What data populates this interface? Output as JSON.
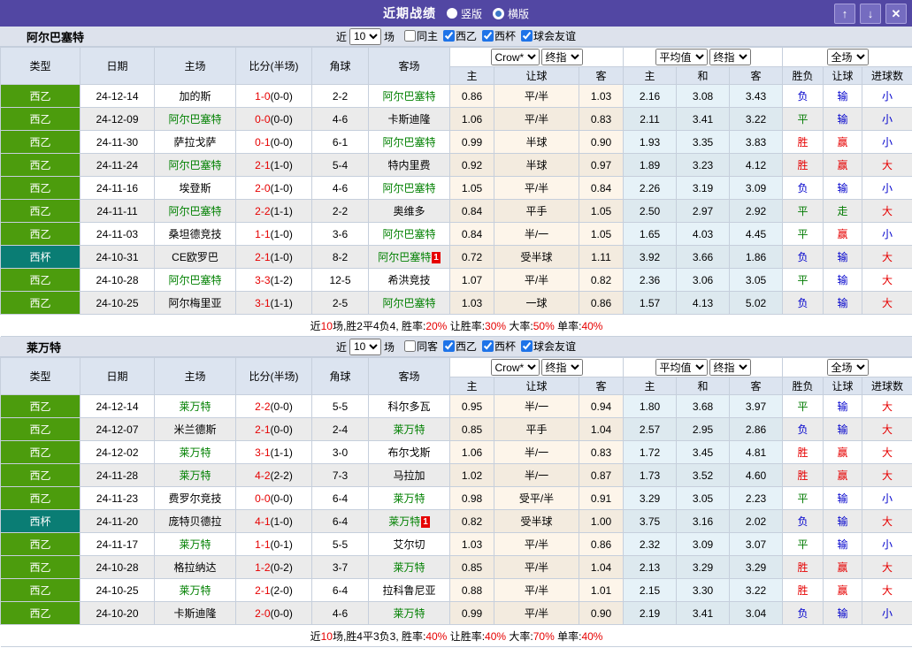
{
  "title_bar": {
    "title": "近期战绩",
    "options": [
      {
        "label": "竖版",
        "selected": false
      },
      {
        "label": "横版",
        "selected": true
      }
    ],
    "buttons": {
      "up": "↑",
      "down": "↓",
      "close": "✕"
    }
  },
  "columns": {
    "type": "类型",
    "date": "日期",
    "home": "主场",
    "score": "比分(半场)",
    "corner": "角球",
    "away": "客场",
    "crow": "Crow*",
    "final": "终指",
    "avg": "平均值",
    "full": "全场",
    "sub_crow": [
      "主",
      "让球",
      "客"
    ],
    "sub_avg": [
      "主",
      "和",
      "客"
    ],
    "sub_result": [
      "胜负",
      "让球",
      "进球数"
    ]
  },
  "type_colors": {
    "西乙": "#4c9c0d",
    "西杯": "#0a7d74"
  },
  "result_colors": {
    "胜": "#e60000",
    "赢": "#e60000",
    "大": "#e60000",
    "平": "#007a00",
    "走": "#007a00",
    "负": "#0000cc",
    "输": "#0000cc",
    "小": "#0000cc"
  },
  "sections": [
    {
      "team": "阿尔巴塞特",
      "filter": {
        "near": "近",
        "count": "10",
        "matches": "场",
        "checks": [
          {
            "label": "同主",
            "checked": false
          },
          {
            "label": "西乙",
            "checked": true
          },
          {
            "label": "西杯",
            "checked": true
          },
          {
            "label": "球会友谊",
            "checked": true
          }
        ]
      },
      "rows": [
        {
          "type": "西乙",
          "date": "24-12-14",
          "home": "加的斯",
          "home_team": false,
          "ft": "1-0",
          "ht": "(0-0)",
          "corner": "2-2",
          "away": "阿尔巴塞特",
          "away_team": true,
          "badge": "",
          "crow": [
            "0.86",
            "平/半",
            "1.03"
          ],
          "avg": [
            "2.16",
            "3.08",
            "3.43"
          ],
          "res": [
            "负",
            "输",
            "小"
          ]
        },
        {
          "type": "西乙",
          "date": "24-12-09",
          "home": "阿尔巴塞特",
          "home_team": true,
          "ft": "0-0",
          "ht": "(0-0)",
          "corner": "4-6",
          "away": "卡斯迪隆",
          "away_team": false,
          "badge": "",
          "crow": [
            "1.06",
            "平/半",
            "0.83"
          ],
          "avg": [
            "2.11",
            "3.41",
            "3.22"
          ],
          "res": [
            "平",
            "输",
            "小"
          ]
        },
        {
          "type": "西乙",
          "date": "24-11-30",
          "home": "萨拉戈萨",
          "home_team": false,
          "ft": "0-1",
          "ht": "(0-0)",
          "corner": "6-1",
          "away": "阿尔巴塞特",
          "away_team": true,
          "badge": "",
          "crow": [
            "0.99",
            "半球",
            "0.90"
          ],
          "avg": [
            "1.93",
            "3.35",
            "3.83"
          ],
          "res": [
            "胜",
            "赢",
            "小"
          ]
        },
        {
          "type": "西乙",
          "date": "24-11-24",
          "home": "阿尔巴塞特",
          "home_team": true,
          "ft": "2-1",
          "ht": "(1-0)",
          "corner": "5-4",
          "away": "特内里费",
          "away_team": false,
          "badge": "",
          "crow": [
            "0.92",
            "半球",
            "0.97"
          ],
          "avg": [
            "1.89",
            "3.23",
            "4.12"
          ],
          "res": [
            "胜",
            "赢",
            "大"
          ]
        },
        {
          "type": "西乙",
          "date": "24-11-16",
          "home": "埃登斯",
          "home_team": false,
          "ft": "2-0",
          "ht": "(1-0)",
          "corner": "4-6",
          "away": "阿尔巴塞特",
          "away_team": true,
          "badge": "",
          "crow": [
            "1.05",
            "平/半",
            "0.84"
          ],
          "avg": [
            "2.26",
            "3.19",
            "3.09"
          ],
          "res": [
            "负",
            "输",
            "小"
          ]
        },
        {
          "type": "西乙",
          "date": "24-11-11",
          "home": "阿尔巴塞特",
          "home_team": true,
          "ft": "2-2",
          "ht": "(1-1)",
          "corner": "2-2",
          "away": "奥维多",
          "away_team": false,
          "badge": "",
          "crow": [
            "0.84",
            "平手",
            "1.05"
          ],
          "avg": [
            "2.50",
            "2.97",
            "2.92"
          ],
          "res": [
            "平",
            "走",
            "大"
          ]
        },
        {
          "type": "西乙",
          "date": "24-11-03",
          "home": "桑坦德竞技",
          "home_team": false,
          "ft": "1-1",
          "ht": "(1-0)",
          "corner": "3-6",
          "away": "阿尔巴塞特",
          "away_team": true,
          "badge": "",
          "crow": [
            "0.84",
            "半/一",
            "1.05"
          ],
          "avg": [
            "1.65",
            "4.03",
            "4.45"
          ],
          "res": [
            "平",
            "赢",
            "小"
          ]
        },
        {
          "type": "西杯",
          "date": "24-10-31",
          "home": "CE欧罗巴",
          "home_team": false,
          "ft": "2-1",
          "ht": "(1-0)",
          "corner": "8-2",
          "away": "阿尔巴塞特",
          "away_team": true,
          "badge": "1",
          "crow": [
            "0.72",
            "受半球",
            "1.11"
          ],
          "avg": [
            "3.92",
            "3.66",
            "1.86"
          ],
          "res": [
            "负",
            "输",
            "大"
          ]
        },
        {
          "type": "西乙",
          "date": "24-10-28",
          "home": "阿尔巴塞特",
          "home_team": true,
          "ft": "3-3",
          "ht": "(1-2)",
          "corner": "12-5",
          "away": "希洪竞技",
          "away_team": false,
          "badge": "",
          "crow": [
            "1.07",
            "平/半",
            "0.82"
          ],
          "avg": [
            "2.36",
            "3.06",
            "3.05"
          ],
          "res": [
            "平",
            "输",
            "大"
          ]
        },
        {
          "type": "西乙",
          "date": "24-10-25",
          "home": "阿尔梅里亚",
          "home_team": false,
          "ft": "3-1",
          "ht": "(1-1)",
          "corner": "2-5",
          "away": "阿尔巴塞特",
          "away_team": true,
          "badge": "",
          "crow": [
            "1.03",
            "一球",
            "0.86"
          ],
          "avg": [
            "1.57",
            "4.13",
            "5.02"
          ],
          "res": [
            "负",
            "输",
            "大"
          ]
        }
      ],
      "summary": [
        [
          "近",
          false
        ],
        [
          "10",
          true
        ],
        [
          "场,胜2平4负4, 胜率:",
          false
        ],
        [
          "20%",
          true
        ],
        [
          " 让胜率:",
          false
        ],
        [
          "30%",
          true
        ],
        [
          " 大率:",
          false
        ],
        [
          "50%",
          true
        ],
        [
          " 单率:",
          false
        ],
        [
          "40%",
          true
        ]
      ]
    },
    {
      "team": "莱万特",
      "filter": {
        "near": "近",
        "count": "10",
        "matches": "场",
        "checks": [
          {
            "label": "同客",
            "checked": false
          },
          {
            "label": "西乙",
            "checked": true
          },
          {
            "label": "西杯",
            "checked": true
          },
          {
            "label": "球会友谊",
            "checked": true
          }
        ]
      },
      "rows": [
        {
          "type": "西乙",
          "date": "24-12-14",
          "home": "莱万特",
          "home_team": true,
          "ft": "2-2",
          "ht": "(0-0)",
          "corner": "5-5",
          "away": "科尔多瓦",
          "away_team": false,
          "badge": "",
          "crow": [
            "0.95",
            "半/一",
            "0.94"
          ],
          "avg": [
            "1.80",
            "3.68",
            "3.97"
          ],
          "res": [
            "平",
            "输",
            "大"
          ]
        },
        {
          "type": "西乙",
          "date": "24-12-07",
          "home": "米兰德斯",
          "home_team": false,
          "ft": "2-1",
          "ht": "(0-0)",
          "corner": "2-4",
          "away": "莱万特",
          "away_team": true,
          "badge": "",
          "crow": [
            "0.85",
            "平手",
            "1.04"
          ],
          "avg": [
            "2.57",
            "2.95",
            "2.86"
          ],
          "res": [
            "负",
            "输",
            "大"
          ]
        },
        {
          "type": "西乙",
          "date": "24-12-02",
          "home": "莱万特",
          "home_team": true,
          "ft": "3-1",
          "ht": "(1-1)",
          "corner": "3-0",
          "away": "布尔戈斯",
          "away_team": false,
          "badge": "",
          "crow": [
            "1.06",
            "半/一",
            "0.83"
          ],
          "avg": [
            "1.72",
            "3.45",
            "4.81"
          ],
          "res": [
            "胜",
            "赢",
            "大"
          ]
        },
        {
          "type": "西乙",
          "date": "24-11-28",
          "home": "莱万特",
          "home_team": true,
          "ft": "4-2",
          "ht": "(2-2)",
          "corner": "7-3",
          "away": "马拉加",
          "away_team": false,
          "badge": "",
          "crow": [
            "1.02",
            "半/一",
            "0.87"
          ],
          "avg": [
            "1.73",
            "3.52",
            "4.60"
          ],
          "res": [
            "胜",
            "赢",
            "大"
          ]
        },
        {
          "type": "西乙",
          "date": "24-11-23",
          "home": "费罗尔竞技",
          "home_team": false,
          "ft": "0-0",
          "ht": "(0-0)",
          "corner": "6-4",
          "away": "莱万特",
          "away_team": true,
          "badge": "",
          "crow": [
            "0.98",
            "受平/半",
            "0.91"
          ],
          "avg": [
            "3.29",
            "3.05",
            "2.23"
          ],
          "res": [
            "平",
            "输",
            "小"
          ]
        },
        {
          "type": "西杯",
          "date": "24-11-20",
          "home": "庞特贝德拉",
          "home_team": false,
          "ft": "4-1",
          "ht": "(1-0)",
          "corner": "6-4",
          "away": "莱万特",
          "away_team": true,
          "badge": "1",
          "crow": [
            "0.82",
            "受半球",
            "1.00"
          ],
          "avg": [
            "3.75",
            "3.16",
            "2.02"
          ],
          "res": [
            "负",
            "输",
            "大"
          ]
        },
        {
          "type": "西乙",
          "date": "24-11-17",
          "home": "莱万特",
          "home_team": true,
          "ft": "1-1",
          "ht": "(0-1)",
          "corner": "5-5",
          "away": "艾尔切",
          "away_team": false,
          "badge": "",
          "crow": [
            "1.03",
            "平/半",
            "0.86"
          ],
          "avg": [
            "2.32",
            "3.09",
            "3.07"
          ],
          "res": [
            "平",
            "输",
            "小"
          ]
        },
        {
          "type": "西乙",
          "date": "24-10-28",
          "home": "格拉纳达",
          "home_team": false,
          "ft": "1-2",
          "ht": "(0-2)",
          "corner": "3-7",
          "away": "莱万特",
          "away_team": true,
          "badge": "",
          "crow": [
            "0.85",
            "平/半",
            "1.04"
          ],
          "avg": [
            "2.13",
            "3.29",
            "3.29"
          ],
          "res": [
            "胜",
            "赢",
            "大"
          ]
        },
        {
          "type": "西乙",
          "date": "24-10-25",
          "home": "莱万特",
          "home_team": true,
          "ft": "2-1",
          "ht": "(2-0)",
          "corner": "6-4",
          "away": "拉科鲁尼亚",
          "away_team": false,
          "badge": "",
          "crow": [
            "0.88",
            "平/半",
            "1.01"
          ],
          "avg": [
            "2.15",
            "3.30",
            "3.22"
          ],
          "res": [
            "胜",
            "赢",
            "大"
          ]
        },
        {
          "type": "西乙",
          "date": "24-10-20",
          "home": "卡斯迪隆",
          "home_team": false,
          "ft": "2-0",
          "ht": "(0-0)",
          "corner": "4-6",
          "away": "莱万特",
          "away_team": true,
          "badge": "",
          "crow": [
            "0.99",
            "平/半",
            "0.90"
          ],
          "avg": [
            "2.19",
            "3.41",
            "3.04"
          ],
          "res": [
            "负",
            "输",
            "小"
          ]
        }
      ],
      "summary": [
        [
          "近",
          false
        ],
        [
          "10",
          true
        ],
        [
          "场,胜4平3负3, 胜率:",
          false
        ],
        [
          "40%",
          true
        ],
        [
          " 让胜率:",
          false
        ],
        [
          "40%",
          true
        ],
        [
          " 大率:",
          false
        ],
        [
          "70%",
          true
        ],
        [
          " 单率:",
          false
        ],
        [
          "40%",
          true
        ]
      ]
    }
  ]
}
